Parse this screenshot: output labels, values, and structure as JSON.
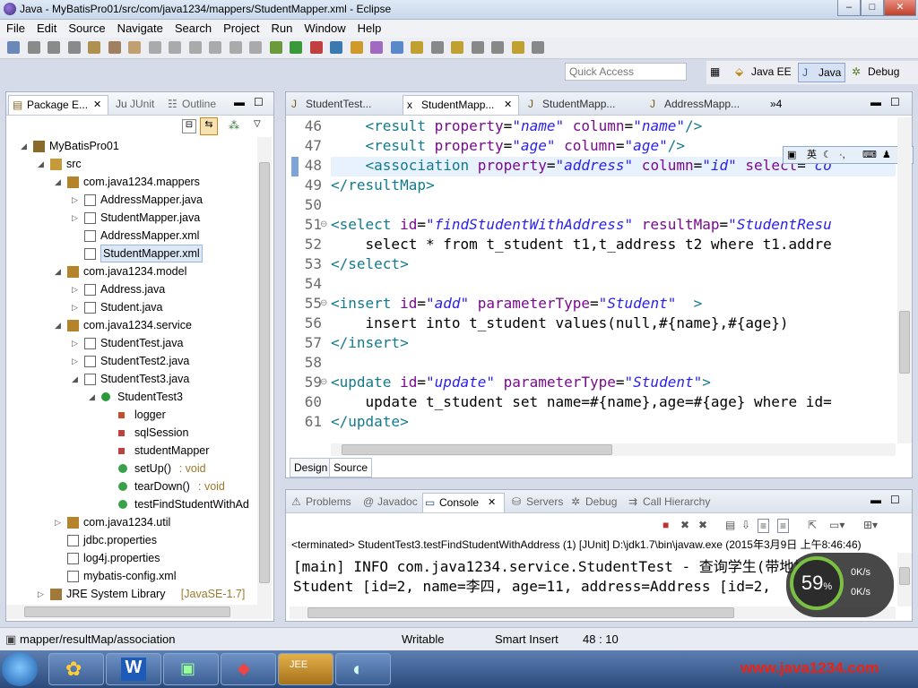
{
  "window": {
    "title": "Java - MyBatisPro01/src/com/java1234/mappers/StudentMapper.xml - Eclipse",
    "min": "–",
    "max": "□",
    "close": "✕"
  },
  "menu": [
    "File",
    "Edit",
    "Source",
    "Navigate",
    "Search",
    "Project",
    "Run",
    "Window",
    "Help"
  ],
  "quick_access": {
    "placeholder": "Quick Access"
  },
  "perspectives": [
    {
      "label": "Java EE"
    },
    {
      "label": "Java"
    },
    {
      "label": "Debug"
    }
  ],
  "left_tabs": [
    "Package E...",
    "JUnit",
    "Outline"
  ],
  "tree": [
    {
      "label": "MyBatisPro01",
      "depth": 0,
      "tw": "◢",
      "icon": "project-icon"
    },
    {
      "label": "src",
      "depth": 1,
      "tw": "◢",
      "icon": "source-folder-icon"
    },
    {
      "label": "com.java1234.mappers",
      "depth": 2,
      "tw": "◢",
      "icon": "package-icon"
    },
    {
      "label": "AddressMapper.java",
      "depth": 3,
      "tw": "▷",
      "icon": "java-file-icon"
    },
    {
      "label": "StudentMapper.java",
      "depth": 3,
      "tw": "▷",
      "icon": "java-file-icon"
    },
    {
      "label": "AddressMapper.xml",
      "depth": 3,
      "tw": "",
      "icon": "xml-file-icon"
    },
    {
      "label": "StudentMapper.xml",
      "depth": 3,
      "tw": "",
      "icon": "xml-file-icon",
      "selected": true
    },
    {
      "label": "com.java1234.model",
      "depth": 2,
      "tw": "◢",
      "icon": "package-icon"
    },
    {
      "label": "Address.java",
      "depth": 3,
      "tw": "▷",
      "icon": "java-file-icon"
    },
    {
      "label": "Student.java",
      "depth": 3,
      "tw": "▷",
      "icon": "java-file-icon"
    },
    {
      "label": "com.java1234.service",
      "depth": 2,
      "tw": "◢",
      "icon": "package-icon"
    },
    {
      "label": "StudentTest.java",
      "depth": 3,
      "tw": "▷",
      "icon": "java-file-icon"
    },
    {
      "label": "StudentTest2.java",
      "depth": 3,
      "tw": "▷",
      "icon": "java-file-icon"
    },
    {
      "label": "StudentTest3.java",
      "depth": 3,
      "tw": "◢",
      "icon": "java-file-icon"
    },
    {
      "label": "StudentTest3",
      "depth": 4,
      "tw": "◢",
      "icon": "class-icon"
    },
    {
      "label": "logger",
      "depth": 5,
      "tw": "",
      "icon": "static-field-icon"
    },
    {
      "label": "sqlSession",
      "depth": 5,
      "tw": "",
      "icon": "private-field-icon"
    },
    {
      "label": "studentMapper",
      "depth": 5,
      "tw": "",
      "icon": "private-field-icon"
    },
    {
      "label": "setUp()",
      "suffix": " : void",
      "depth": 5,
      "tw": "",
      "icon": "method-icon"
    },
    {
      "label": "tearDown()",
      "suffix": " : void",
      "depth": 5,
      "tw": "",
      "icon": "method-icon"
    },
    {
      "label": "testFindStudentWithAd",
      "depth": 5,
      "tw": "",
      "icon": "method-icon"
    },
    {
      "label": "com.java1234.util",
      "depth": 2,
      "tw": "▷",
      "icon": "package-icon"
    },
    {
      "label": "jdbc.properties",
      "depth": 2,
      "tw": "",
      "icon": "properties-file-icon"
    },
    {
      "label": "log4j.properties",
      "depth": 2,
      "tw": "",
      "icon": "properties-file-icon"
    },
    {
      "label": "mybatis-config.xml",
      "depth": 2,
      "tw": "",
      "icon": "xml-file-icon"
    },
    {
      "label": "JRE System Library",
      "suffix": " [JavaSE-1.7]",
      "depth": 1,
      "tw": "▷",
      "icon": "library-icon"
    }
  ],
  "editor_tabs": [
    "StudentTest...",
    "StudentMapp...",
    "StudentMapp...",
    "AddressMapp..."
  ],
  "editor_overflow": "»4",
  "code": [
    {
      "n": "46",
      "fold": "",
      "parts": [
        [
          "t",
          "    <"
        ],
        [
          "t",
          "result "
        ],
        [
          "a",
          "property"
        ],
        [
          "k",
          "="
        ],
        [
          "v",
          "\"name\""
        ],
        [
          "a",
          " column"
        ],
        [
          "k",
          "="
        ],
        [
          "v",
          "\"name\""
        ],
        [
          "t",
          "/>"
        ]
      ]
    },
    {
      "n": "47",
      "fold": "",
      "parts": [
        [
          "t",
          "    <result "
        ],
        [
          "a",
          "property"
        ],
        [
          "k",
          "="
        ],
        [
          "v",
          "\"age\""
        ],
        [
          "a",
          " column"
        ],
        [
          "k",
          "="
        ],
        [
          "v",
          "\"age\""
        ],
        [
          "t",
          "/>"
        ]
      ]
    },
    {
      "n": "48",
      "fold": "",
      "parts": [
        [
          "t",
          "    <association "
        ],
        [
          "a",
          "property"
        ],
        [
          "k",
          "="
        ],
        [
          "v",
          "\"address\""
        ],
        [
          "a",
          " column"
        ],
        [
          "k",
          "="
        ],
        [
          "v",
          "\"id\""
        ],
        [
          "a",
          " select"
        ],
        [
          "k",
          "="
        ],
        [
          "v",
          "\"co"
        ]
      ]
    },
    {
      "n": "49",
      "fold": "",
      "parts": [
        [
          "t",
          "</resultMap>"
        ]
      ]
    },
    {
      "n": "50",
      "fold": "",
      "parts": [
        [
          "k",
          ""
        ]
      ]
    },
    {
      "n": "51",
      "fold": "⊖",
      "parts": [
        [
          "t",
          "<select "
        ],
        [
          "a",
          "id"
        ],
        [
          "k",
          "="
        ],
        [
          "v",
          "\"findStudentWithAddress\""
        ],
        [
          "a",
          " resultMap"
        ],
        [
          "k",
          "="
        ],
        [
          "v",
          "\"StudentResu"
        ]
      ]
    },
    {
      "n": "52",
      "fold": "",
      "parts": [
        [
          "k",
          "    select * from t_student t1,t_address t2 where t1.addre"
        ]
      ]
    },
    {
      "n": "53",
      "fold": "",
      "parts": [
        [
          "t",
          "</select>"
        ]
      ]
    },
    {
      "n": "54",
      "fold": "",
      "parts": [
        [
          "k",
          ""
        ]
      ]
    },
    {
      "n": "55",
      "fold": "⊖",
      "parts": [
        [
          "t",
          "<insert "
        ],
        [
          "a",
          "id"
        ],
        [
          "k",
          "="
        ],
        [
          "v",
          "\"add\""
        ],
        [
          "a",
          " parameterType"
        ],
        [
          "k",
          "="
        ],
        [
          "v",
          "\"Student\""
        ],
        [
          "t",
          "  >"
        ]
      ]
    },
    {
      "n": "56",
      "fold": "",
      "parts": [
        [
          "k",
          "    insert into t_student values(null,#{name},#{age})"
        ]
      ]
    },
    {
      "n": "57",
      "fold": "",
      "parts": [
        [
          "t",
          "</insert>"
        ]
      ]
    },
    {
      "n": "58",
      "fold": "",
      "parts": [
        [
          "k",
          ""
        ]
      ]
    },
    {
      "n": "59",
      "fold": "⊖",
      "parts": [
        [
          "t",
          "<update "
        ],
        [
          "a",
          "id"
        ],
        [
          "k",
          "="
        ],
        [
          "v",
          "\"update\""
        ],
        [
          "a",
          " parameterType"
        ],
        [
          "k",
          "="
        ],
        [
          "v",
          "\"Student\""
        ],
        [
          "t",
          ">"
        ]
      ]
    },
    {
      "n": "60",
      "fold": "",
      "parts": [
        [
          "k",
          "    update t_student set name=#{name},age=#{age} where id="
        ]
      ]
    },
    {
      "n": "61",
      "fold": "",
      "parts": [
        [
          "t",
          "</update>"
        ]
      ]
    }
  ],
  "ime_label": "英",
  "design_tab": "Design",
  "source_tab": "Source",
  "bottom_tabs": [
    "Problems",
    "Javadoc",
    "Console",
    "Servers",
    "Debug",
    "Call Hierarchy"
  ],
  "console": {
    "header": "<terminated> StudentTest3.testFindStudentWithAddress (1) [JUnit] D:\\jdk1.7\\bin\\javaw.exe (2015年3月9日 上午8:46:46)",
    "lines": [
      "[main] INFO com.java1234.service.StudentTest - 查询学生(带地址)",
      "Student [id=2, name=李四, age=11, address=Address [id=2,"
    ]
  },
  "net_widget": {
    "percent": "59",
    "unit": "%",
    "up": "0K/s",
    "down": "0K/s"
  },
  "status": {
    "path": "mapper/resultMap/association",
    "mode": "Writable",
    "insert": "Smart Insert",
    "pos": "48 : 10"
  },
  "watermark": "www.java1234.com",
  "colors": {
    "tag": "#127a8c",
    "attr": "#7a0a8f",
    "value": "#2a1ff0"
  }
}
